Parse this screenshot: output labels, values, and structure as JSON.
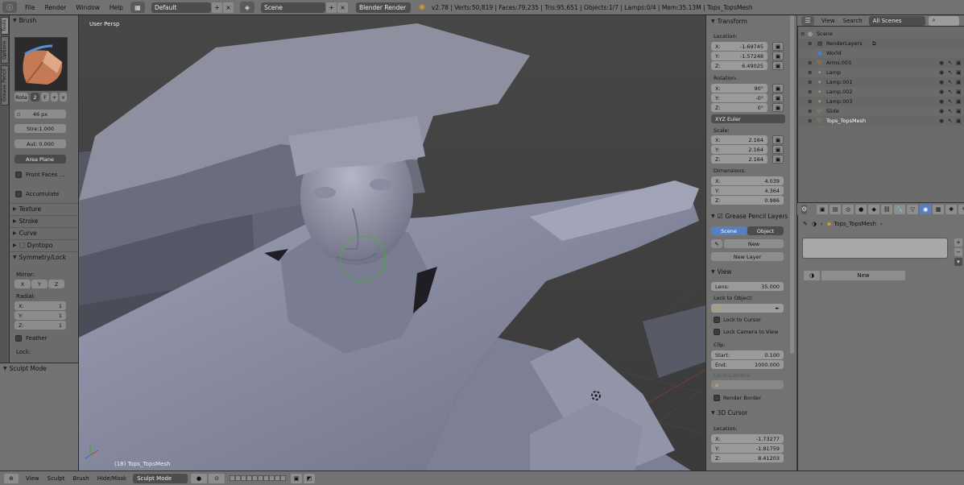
{
  "colors": {
    "header_bg": "#727272",
    "viewport_bg": "#3d3d3d",
    "mesh_light": "#8c8ea0",
    "accent_blue": "#5680c2"
  },
  "topbar": {
    "menu": [
      "File",
      "Render",
      "Window",
      "Help"
    ],
    "layout": "Default",
    "scene": "Scene",
    "engine": "Blender Render",
    "stats": "v2.78 | Verts:50,819 | Faces:79,235 | Tris:95,651 | Objects:1/7 | Lamps:0/4 | Mem:35.13M | Tops_TopsMesh"
  },
  "tabs": [
    "Tools",
    "Options",
    "Grease Pencil"
  ],
  "toolshelf": {
    "brush_header": "Brush",
    "rota": "Rota",
    "rota_num": "2",
    "rota_f": "F",
    "radius": "46 px",
    "strength": "Stre:1.000",
    "autosmooth": "Aut: 0.000",
    "plane": "Area Plane",
    "front_faces": "Front Faces ...",
    "accumulate": "Accumulate",
    "collapsed": [
      "Texture",
      "Stroke",
      "Curve",
      "Dyntopo"
    ],
    "symmetry_header": "Symmetry/Lock",
    "mirror_label": "Mirror:",
    "mirror": [
      "X",
      "Y",
      "Z"
    ],
    "radial_label": "Radial:",
    "radial": [
      {
        "axis": "X:",
        "value": "1"
      },
      {
        "axis": "Y:",
        "value": "1"
      },
      {
        "axis": "Z:",
        "value": "1"
      }
    ],
    "feather": "Feather",
    "lock_label": "Lock:",
    "sculpt_mode_header": "Sculpt Mode"
  },
  "viewport": {
    "view_label": "User Persp",
    "object_label": "(18) Tops_TopsMesh"
  },
  "npanel": {
    "transform_header": "Transform",
    "location_label": "Location:",
    "location": [
      {
        "axis": "X:",
        "value": "-1.69745"
      },
      {
        "axis": "Y:",
        "value": "-1.57248"
      },
      {
        "axis": "Z:",
        "value": "6.49025"
      }
    ],
    "rotation_label": "Rotation:",
    "rotation": [
      {
        "axis": "X:",
        "value": "90°"
      },
      {
        "axis": "Y:",
        "value": "-0°"
      },
      {
        "axis": "Z:",
        "value": "0°"
      }
    ],
    "rotation_mode": "XYZ Euler",
    "scale_label": "Scale:",
    "scale": [
      {
        "axis": "X:",
        "value": "2.164"
      },
      {
        "axis": "Y:",
        "value": "2.164"
      },
      {
        "axis": "Z:",
        "value": "2.164"
      }
    ],
    "dimensions_label": "Dimensions:",
    "dimensions": [
      {
        "axis": "X:",
        "value": "4.039"
      },
      {
        "axis": "Y:",
        "value": "4.364"
      },
      {
        "axis": "Z:",
        "value": "0.986"
      }
    ],
    "grease_header": "Grease Pencil Layers",
    "gp_scene": "Scene",
    "gp_object": "Object",
    "gp_new": "New",
    "gp_new_layer": "New Layer",
    "view_header": "View",
    "lens_label": "Lens:",
    "lens_value": "35.000",
    "lock_object_label": "Lock to Object:",
    "lock_cursor": "Lock to Cursor",
    "lock_camera": "Lock Camera to View",
    "clip_label": "Clip:",
    "clip_start_label": "Start:",
    "clip_start": "0.100",
    "clip_end_label": "End:",
    "clip_end": "1000.000",
    "local_camera_label": "Local Camera:",
    "render_border": "Render Border",
    "cursor_header": "3D Cursor",
    "cursor_location_label": "Location:",
    "cursor": [
      {
        "axis": "X:",
        "value": "-1.73277"
      },
      {
        "axis": "Y:",
        "value": "-1.81759"
      },
      {
        "axis": "Z:",
        "value": "8.41203"
      }
    ]
  },
  "outliner": {
    "view": "View",
    "search": "Search",
    "scenes": "All Scenes",
    "rows": [
      {
        "name": "Scene"
      },
      {
        "name": "RenderLayers"
      },
      {
        "name": "World"
      },
      {
        "name": "Arms.003"
      },
      {
        "name": "Lamp"
      },
      {
        "name": "Lamp.001"
      },
      {
        "name": "Lamp.002"
      },
      {
        "name": "Lamp.003"
      },
      {
        "name": "Slide"
      },
      {
        "name": "Tops_TopsMesh"
      }
    ]
  },
  "props": {
    "object_name": "Tops_TopsMesh",
    "new_button": "New"
  },
  "bottombar": {
    "menu": [
      "View",
      "Sculpt",
      "Brush",
      "Hide/Mask"
    ],
    "mode": "Sculpt Mode"
  }
}
